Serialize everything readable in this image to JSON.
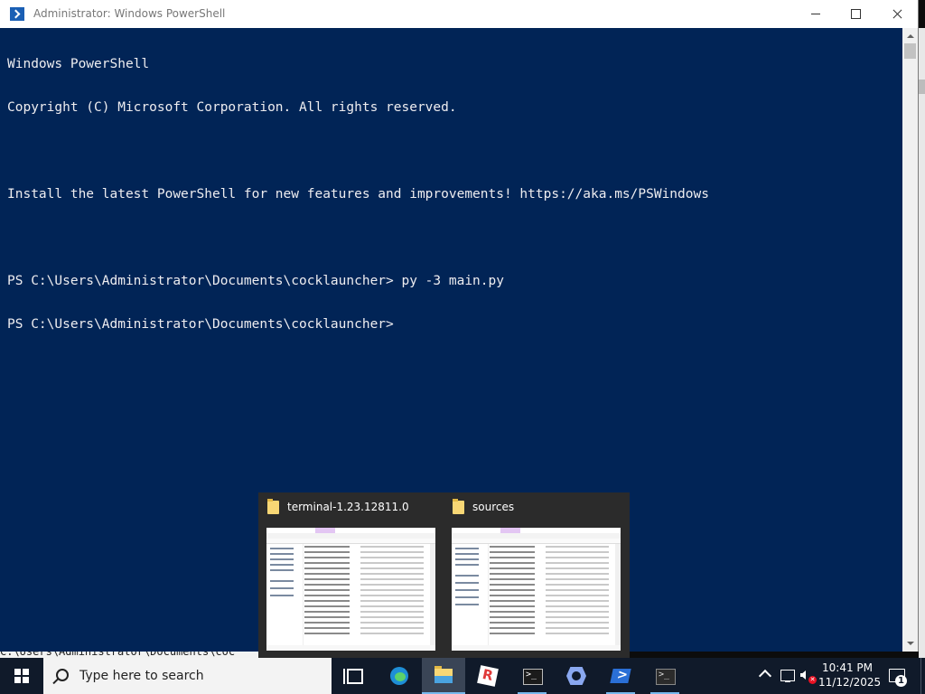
{
  "background_console": {
    "edge_chars": [
      "C",
      "/",
      "\\",
      "C",
      "C",
      "C",
      "C",
      "C",
      "C"
    ],
    "bottom_line": "C:\\Users\\Administrator\\Documents\\coc"
  },
  "powershell_window": {
    "title": "Administrator: Windows PowerShell",
    "lines": [
      "Windows PowerShell",
      "Copyright (C) Microsoft Corporation. All rights reserved.",
      "",
      "Install the latest PowerShell for new features and improvements! https://aka.ms/PSWindows",
      "",
      "PS C:\\Users\\Administrator\\Documents\\cocklauncher> py -3 main.py",
      "PS C:\\Users\\Administrator\\Documents\\cocklauncher>"
    ],
    "colors": {
      "background": "#012456",
      "text": "#eeedf0"
    }
  },
  "previews": [
    {
      "name": "terminal-1.23.12811.0",
      "icon": "folder-icon"
    },
    {
      "name": "sources",
      "icon": "folder-icon"
    }
  ],
  "taskbar": {
    "search_placeholder": "Type here to search",
    "apps": [
      {
        "name": "task-view",
        "icon": "task-view-icon"
      },
      {
        "name": "edge",
        "icon": "edge-icon"
      },
      {
        "name": "file-explorer",
        "icon": "folder-icon",
        "state": "active"
      },
      {
        "name": "roblox",
        "icon": "roblox-icon"
      },
      {
        "name": "command-prompt",
        "icon": "cmd-icon",
        "state": "open"
      },
      {
        "name": "visual-studio",
        "icon": "visual-studio-icon"
      },
      {
        "name": "powershell",
        "icon": "powershell-icon",
        "state": "open"
      },
      {
        "name": "windows-terminal",
        "icon": "terminal-icon",
        "state": "open"
      }
    ],
    "clock": {
      "time": "10:41 PM",
      "date": "11/12/2025"
    },
    "notification_count": "1"
  }
}
